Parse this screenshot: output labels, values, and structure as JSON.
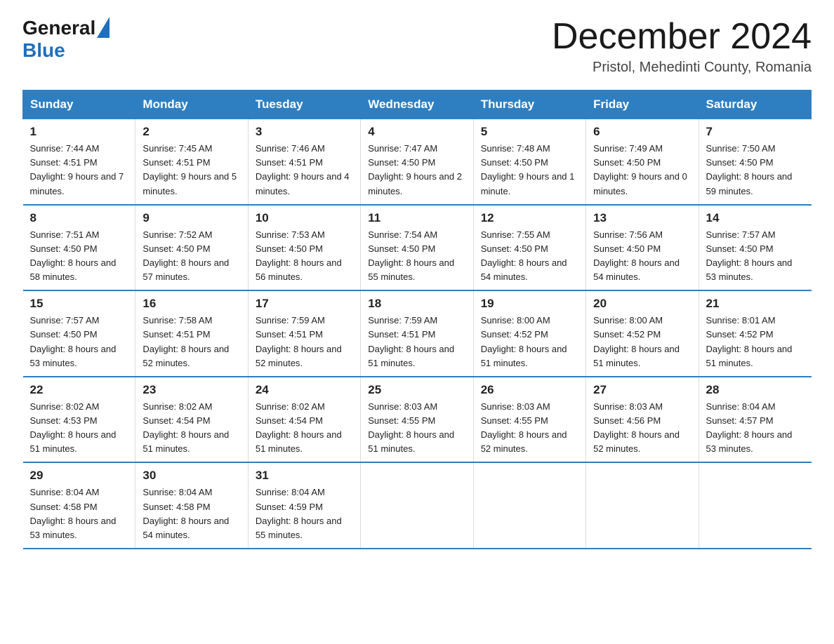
{
  "header": {
    "logo_general": "General",
    "logo_blue": "Blue",
    "month_title": "December 2024",
    "location": "Pristol, Mehedinti County, Romania"
  },
  "weekdays": [
    "Sunday",
    "Monday",
    "Tuesday",
    "Wednesday",
    "Thursday",
    "Friday",
    "Saturday"
  ],
  "weeks": [
    [
      {
        "day": "1",
        "sunrise": "7:44 AM",
        "sunset": "4:51 PM",
        "daylight": "9 hours and 7 minutes."
      },
      {
        "day": "2",
        "sunrise": "7:45 AM",
        "sunset": "4:51 PM",
        "daylight": "9 hours and 5 minutes."
      },
      {
        "day": "3",
        "sunrise": "7:46 AM",
        "sunset": "4:51 PM",
        "daylight": "9 hours and 4 minutes."
      },
      {
        "day": "4",
        "sunrise": "7:47 AM",
        "sunset": "4:50 PM",
        "daylight": "9 hours and 2 minutes."
      },
      {
        "day": "5",
        "sunrise": "7:48 AM",
        "sunset": "4:50 PM",
        "daylight": "9 hours and 1 minute."
      },
      {
        "day": "6",
        "sunrise": "7:49 AM",
        "sunset": "4:50 PM",
        "daylight": "9 hours and 0 minutes."
      },
      {
        "day": "7",
        "sunrise": "7:50 AM",
        "sunset": "4:50 PM",
        "daylight": "8 hours and 59 minutes."
      }
    ],
    [
      {
        "day": "8",
        "sunrise": "7:51 AM",
        "sunset": "4:50 PM",
        "daylight": "8 hours and 58 minutes."
      },
      {
        "day": "9",
        "sunrise": "7:52 AM",
        "sunset": "4:50 PM",
        "daylight": "8 hours and 57 minutes."
      },
      {
        "day": "10",
        "sunrise": "7:53 AM",
        "sunset": "4:50 PM",
        "daylight": "8 hours and 56 minutes."
      },
      {
        "day": "11",
        "sunrise": "7:54 AM",
        "sunset": "4:50 PM",
        "daylight": "8 hours and 55 minutes."
      },
      {
        "day": "12",
        "sunrise": "7:55 AM",
        "sunset": "4:50 PM",
        "daylight": "8 hours and 54 minutes."
      },
      {
        "day": "13",
        "sunrise": "7:56 AM",
        "sunset": "4:50 PM",
        "daylight": "8 hours and 54 minutes."
      },
      {
        "day": "14",
        "sunrise": "7:57 AM",
        "sunset": "4:50 PM",
        "daylight": "8 hours and 53 minutes."
      }
    ],
    [
      {
        "day": "15",
        "sunrise": "7:57 AM",
        "sunset": "4:50 PM",
        "daylight": "8 hours and 53 minutes."
      },
      {
        "day": "16",
        "sunrise": "7:58 AM",
        "sunset": "4:51 PM",
        "daylight": "8 hours and 52 minutes."
      },
      {
        "day": "17",
        "sunrise": "7:59 AM",
        "sunset": "4:51 PM",
        "daylight": "8 hours and 52 minutes."
      },
      {
        "day": "18",
        "sunrise": "7:59 AM",
        "sunset": "4:51 PM",
        "daylight": "8 hours and 51 minutes."
      },
      {
        "day": "19",
        "sunrise": "8:00 AM",
        "sunset": "4:52 PM",
        "daylight": "8 hours and 51 minutes."
      },
      {
        "day": "20",
        "sunrise": "8:00 AM",
        "sunset": "4:52 PM",
        "daylight": "8 hours and 51 minutes."
      },
      {
        "day": "21",
        "sunrise": "8:01 AM",
        "sunset": "4:52 PM",
        "daylight": "8 hours and 51 minutes."
      }
    ],
    [
      {
        "day": "22",
        "sunrise": "8:02 AM",
        "sunset": "4:53 PM",
        "daylight": "8 hours and 51 minutes."
      },
      {
        "day": "23",
        "sunrise": "8:02 AM",
        "sunset": "4:54 PM",
        "daylight": "8 hours and 51 minutes."
      },
      {
        "day": "24",
        "sunrise": "8:02 AM",
        "sunset": "4:54 PM",
        "daylight": "8 hours and 51 minutes."
      },
      {
        "day": "25",
        "sunrise": "8:03 AM",
        "sunset": "4:55 PM",
        "daylight": "8 hours and 51 minutes."
      },
      {
        "day": "26",
        "sunrise": "8:03 AM",
        "sunset": "4:55 PM",
        "daylight": "8 hours and 52 minutes."
      },
      {
        "day": "27",
        "sunrise": "8:03 AM",
        "sunset": "4:56 PM",
        "daylight": "8 hours and 52 minutes."
      },
      {
        "day": "28",
        "sunrise": "8:04 AM",
        "sunset": "4:57 PM",
        "daylight": "8 hours and 53 minutes."
      }
    ],
    [
      {
        "day": "29",
        "sunrise": "8:04 AM",
        "sunset": "4:58 PM",
        "daylight": "8 hours and 53 minutes."
      },
      {
        "day": "30",
        "sunrise": "8:04 AM",
        "sunset": "4:58 PM",
        "daylight": "8 hours and 54 minutes."
      },
      {
        "day": "31",
        "sunrise": "8:04 AM",
        "sunset": "4:59 PM",
        "daylight": "8 hours and 55 minutes."
      },
      null,
      null,
      null,
      null
    ]
  ],
  "labels": {
    "sunrise": "Sunrise:",
    "sunset": "Sunset:",
    "daylight": "Daylight:"
  }
}
